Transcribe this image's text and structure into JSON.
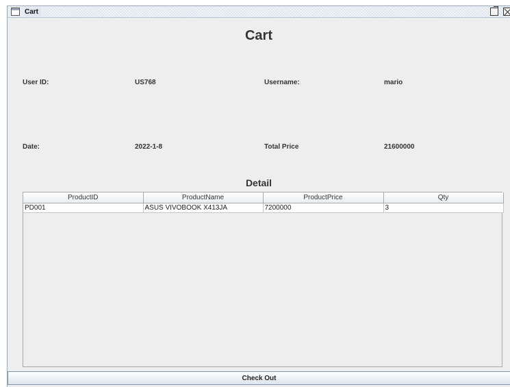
{
  "window": {
    "title": "Cart"
  },
  "header": {
    "title": "Cart"
  },
  "info": {
    "user_id_label": "User ID:",
    "user_id_value": "US768",
    "username_label": "Username:",
    "username_value": "mario",
    "date_label": "Date:",
    "date_value": "2022-1-8",
    "total_price_label": "Total Price",
    "total_price_value": "21600000"
  },
  "detail": {
    "title": "Detail",
    "columns": [
      "ProductID",
      "ProductName",
      "ProductPrice",
      "Qty"
    ],
    "rows": [
      [
        "PD001",
        "ASUS VIVOBOOK X413JA",
        "7200000",
        "3"
      ]
    ]
  },
  "actions": {
    "checkout_label": "Check Out"
  }
}
